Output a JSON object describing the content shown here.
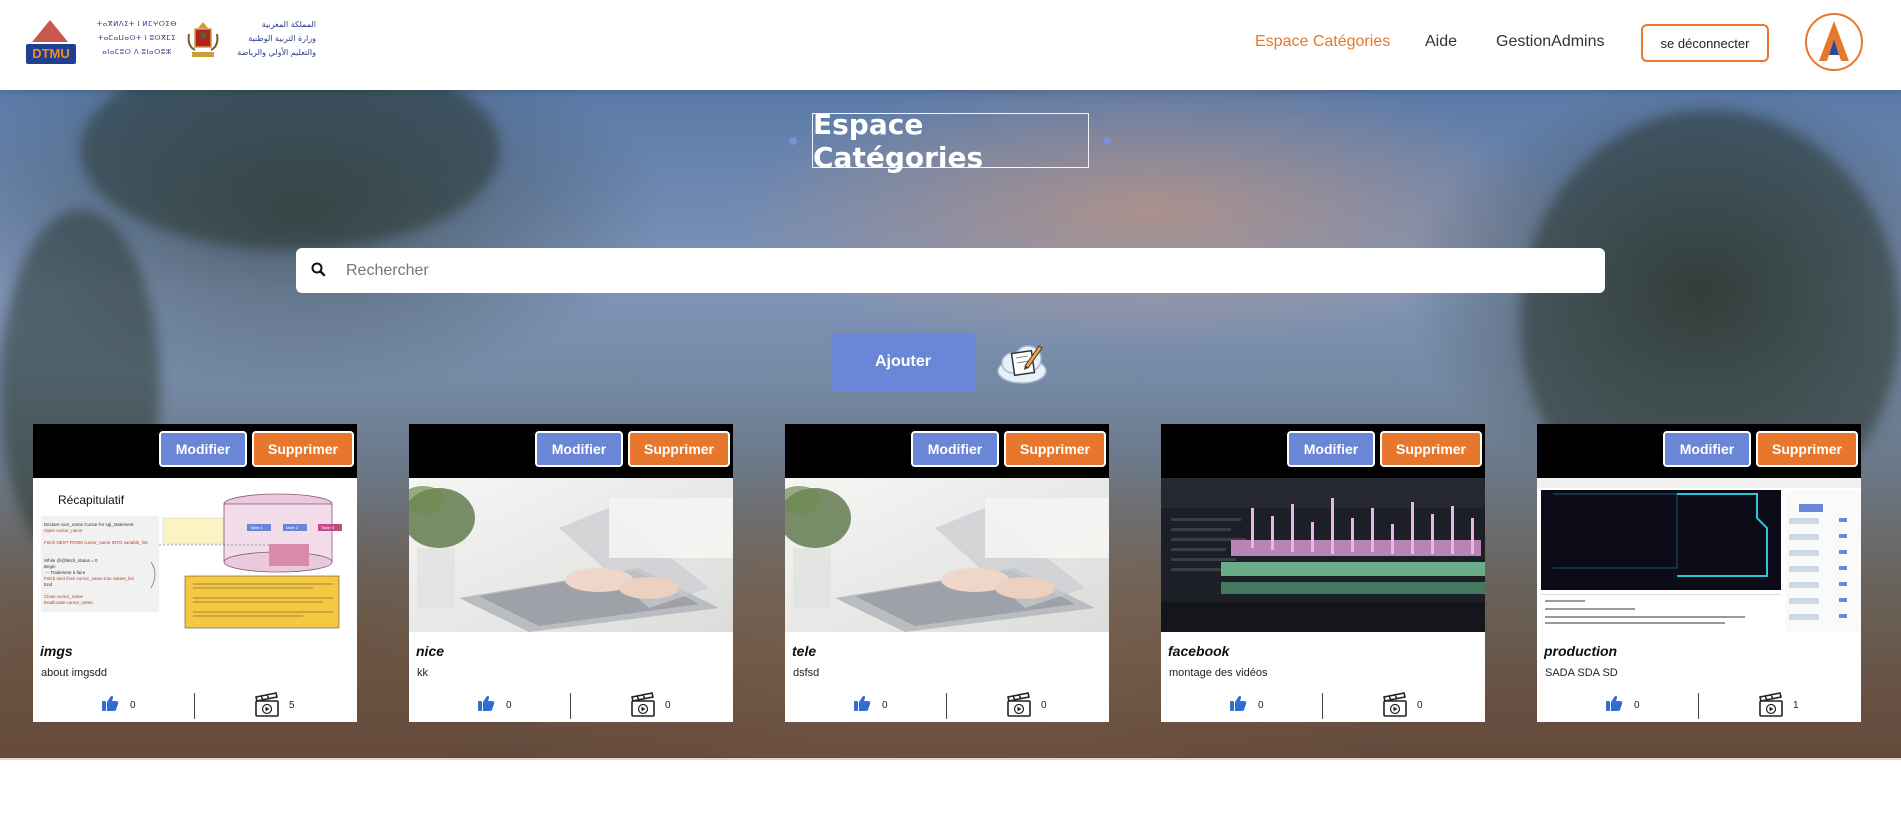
{
  "header": {
    "logo_text": "DTMU",
    "ministry_tifinagh": [
      "ⵜⴰⴳⵍⴷⵉⵜ ⵏ ⵍⵎⵖⵔⵉⴱ",
      "ⵜⴰⵎⴰⵡⴰⵙⵜ ⵏ ⵓⵙⴳⵎⵉ",
      "ⴰⵏⴰⵎⵓⵔ ⴷ ⵓⵏⴰⵔⵓⵣ"
    ],
    "ministry_arabic": [
      "المملكة المغربية",
      "وزارة التربية الوطنية",
      "والتعليم الأولي والرياضة"
    ],
    "nav": [
      {
        "label": "Espace Catégories",
        "active": true
      },
      {
        "label": "Aide",
        "active": false
      },
      {
        "label": "GestionAdmins",
        "active": false
      }
    ],
    "logout_label": "se déconnecter"
  },
  "page": {
    "title": "Espace Catégories",
    "search_placeholder": "Rechercher",
    "add_label": "Ajouter"
  },
  "colors": {
    "accent_orange": "#e8772e",
    "accent_blue": "#6a86d6"
  },
  "cards": [
    {
      "name": "imgs",
      "description": "about imgsdd",
      "likes": "0",
      "videos": "5",
      "modify_label": "Modifier",
      "delete_label": "Supprimer",
      "thumbnail": "diagram-slide",
      "slide": {
        "title": "Récapitulatif",
        "lines": [
          "Declare curs_name Cursor for sql_statement",
          "Open cursor_name",
          "Fetch NEXT FROM cursor_name INTO variable_list;",
          "While @@fetch_status = 0",
          "Begin",
          "-- Traitement à faire",
          "Fetch next from cursor_name Into values_list",
          "End",
          "Close cursor_name",
          "Deallocate cursor_name"
        ],
        "tables": [
          "Table 1",
          "table 2",
          "Table 3"
        ]
      }
    },
    {
      "name": "nice",
      "description": "kk",
      "likes": "0",
      "videos": "0",
      "modify_label": "Modifier",
      "delete_label": "Supprimer",
      "thumbnail": "laptop-photo"
    },
    {
      "name": "tele",
      "description": "dsfsd",
      "likes": "0",
      "videos": "0",
      "modify_label": "Modifier",
      "delete_label": "Supprimer",
      "thumbnail": "laptop-photo"
    },
    {
      "name": "facebook",
      "description": "montage des vidéos",
      "likes": "0",
      "videos": "0",
      "modify_label": "Modifier",
      "delete_label": "Supprimer",
      "thumbnail": "video-editing-photo"
    },
    {
      "name": "production",
      "description": "SADA SDA SD",
      "likes": "0",
      "videos": "1",
      "modify_label": "Modifier",
      "delete_label": "Supprimer",
      "thumbnail": "app-screenshot"
    }
  ]
}
